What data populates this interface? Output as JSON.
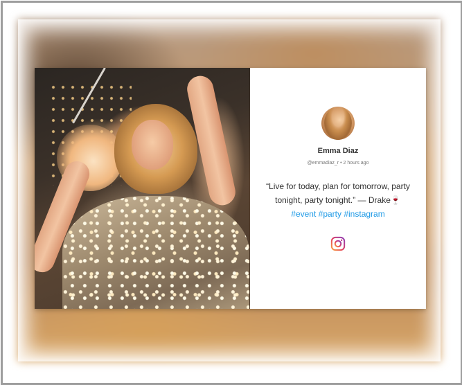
{
  "post": {
    "author_name": "Emma Diaz",
    "handle": "@emmadiaz_r",
    "time_ago": "2 hours ago",
    "quote_text": "“Live for today, plan for tomorrow, party tonight, party tonight.” — Drake",
    "emoji": "🍷",
    "hashtags": [
      "#event",
      "#party",
      "#instagram"
    ]
  },
  "icons": {
    "platform": "instagram-icon",
    "emoji": "wine-glass-emoji"
  },
  "colors": {
    "hashtag": "#1f9ae6",
    "text": "#333333",
    "meta": "#777777",
    "frame": "#9e9e9e"
  }
}
